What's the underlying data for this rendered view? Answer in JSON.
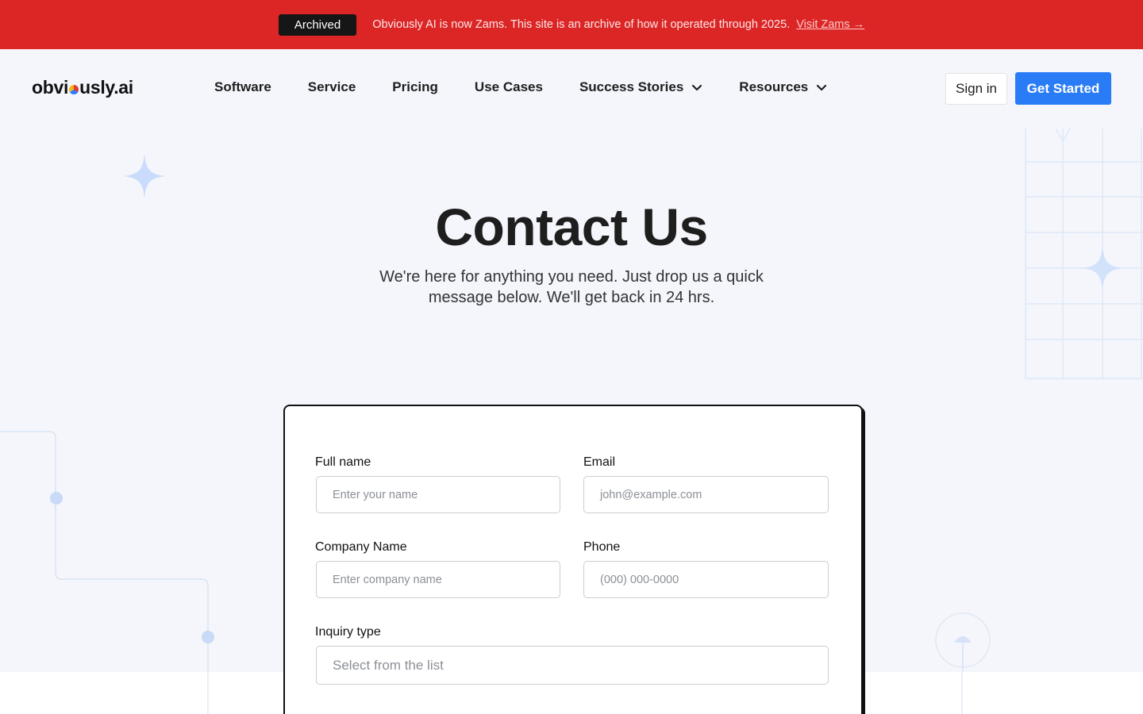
{
  "banner": {
    "badge": "Archived",
    "message": "Obviously AI is now Zams. This site is an archive of how it operated through 2025.",
    "link": "Visit Zams →"
  },
  "nav": {
    "logo": {
      "before": "obvi",
      "after": "usly.ai"
    },
    "items": [
      {
        "label": "Software",
        "dropdown": false
      },
      {
        "label": "Service",
        "dropdown": false
      },
      {
        "label": "Pricing",
        "dropdown": false
      },
      {
        "label": "Use Cases",
        "dropdown": false
      },
      {
        "label": "Success Stories",
        "dropdown": true
      },
      {
        "label": "Resources",
        "dropdown": true
      }
    ],
    "signin": "Sign in",
    "get_started": "Get Started"
  },
  "hero": {
    "title": "Contact Us",
    "subtitle": "We're here for anything you need. Just drop us a quick message below. We'll get back in 24 hrs."
  },
  "form": {
    "full_name": {
      "label": "Full name",
      "placeholder": "Enter your name"
    },
    "email": {
      "label": "Email",
      "placeholder": "john@example.com"
    },
    "company": {
      "label": "Company Name",
      "placeholder": "Enter company name"
    },
    "phone": {
      "label": "Phone",
      "placeholder": "(000) 000-0000"
    },
    "inquiry": {
      "label": "Inquiry type",
      "placeholder": "Select from the list"
    }
  },
  "colors": {
    "banner": "#dc2626",
    "accent": "#2a7cf6",
    "hero_bg": "#f4f6fc"
  },
  "icons": {
    "sparkle": "sparkle-icon",
    "chevron": "chevron-down-icon"
  }
}
